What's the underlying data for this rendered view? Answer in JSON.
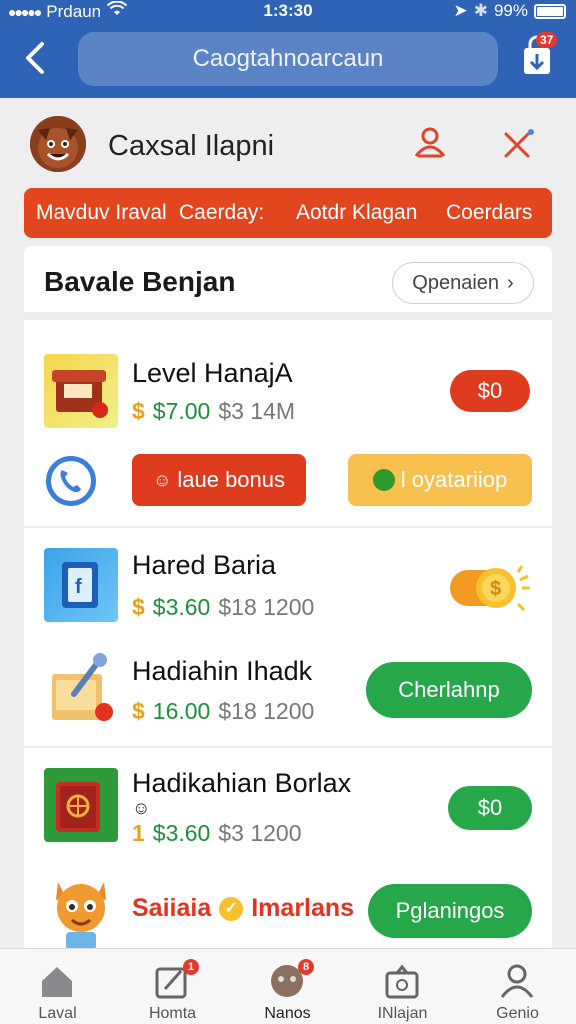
{
  "status": {
    "carrier": "Prdaun",
    "time": "1:3:30",
    "battery": "99%"
  },
  "header": {
    "title": "Caogtahnoarcaun",
    "cart_badge": "37"
  },
  "profile": {
    "name": "Caxsal Ilapni"
  },
  "tabs": [
    "Mavduv Iraval",
    "Caerday:",
    "Aotdr Klagan",
    "Coerdars"
  ],
  "section": {
    "title": "Bavale Benjan",
    "button": "Qpenaien"
  },
  "items": [
    {
      "title": "Level HanajA",
      "price": "$7.00",
      "old": "$3 14M",
      "action": "$0"
    },
    {
      "title": "Hared Baria",
      "price": "$3.60",
      "old": "$18 1200"
    },
    {
      "title": "Hadiahin Ihadk",
      "price": "16.00",
      "old": "$18 1200",
      "action": "Cherlahnp"
    },
    {
      "title": "Hadikahian Borlax",
      "price": "$3.60",
      "old": "$3 1200",
      "action": "$0"
    },
    {
      "title": "Saiiaia",
      "title2": "Imarlans",
      "action": "Pglaningos"
    }
  ],
  "buttons": {
    "bonus": "laue bonus",
    "loyalty": "l oyatariiop"
  },
  "nav": [
    {
      "label": "Laval"
    },
    {
      "label": "Homta",
      "badge": "1"
    },
    {
      "label": "Nanos",
      "badge": "8"
    },
    {
      "label": "INlajan"
    },
    {
      "label": "Genio"
    }
  ],
  "colors": {
    "header": "#2f63b5",
    "orange": "#e2461e",
    "green": "#26a74a",
    "price_green": "#1e8f3a",
    "gold": "#e8a21a",
    "badge": "#e23b2e"
  },
  "icons": [
    "back-icon",
    "cart-icon",
    "user-icon",
    "close-icon",
    "phone-icon",
    "coin-icon",
    "home-icon",
    "edit-icon",
    "account-icon"
  ]
}
